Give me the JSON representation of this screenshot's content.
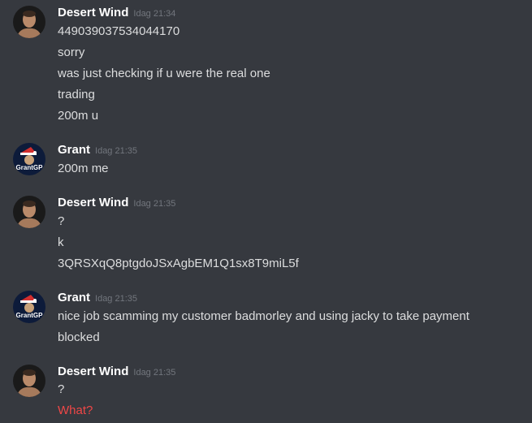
{
  "messages": [
    {
      "author": "Desert Wind",
      "timestamp": "Idag 21:34",
      "avatar_icon": "fighter-portrait-icon",
      "lines": [
        {
          "text": "449039037534044170"
        },
        {
          "text": "sorry"
        },
        {
          "text": "was just checking if u were the real one"
        },
        {
          "text": "trading"
        },
        {
          "text": "200m u"
        }
      ]
    },
    {
      "author": "Grant",
      "timestamp": "Idag 21:35",
      "avatar_icon": "grant-logo-icon",
      "avatar_text": "GrantGP",
      "lines": [
        {
          "text": "200m me"
        }
      ]
    },
    {
      "author": "Desert Wind",
      "timestamp": "Idag 21:35",
      "avatar_icon": "fighter-portrait-icon",
      "lines": [
        {
          "text": "?"
        },
        {
          "text": "k"
        },
        {
          "text": "3QRSXqQ8ptgdoJSxAgbEM1Q1sx8T9miL5f"
        }
      ]
    },
    {
      "author": "Grant",
      "timestamp": "Idag 21:35",
      "avatar_icon": "grant-logo-icon",
      "avatar_text": "GrantGP",
      "lines": [
        {
          "text": "nice job scamming my customer badmorley and using jacky to take payment"
        },
        {
          "text": "blocked"
        }
      ]
    },
    {
      "author": "Desert Wind",
      "timestamp": "Idag 21:35",
      "avatar_icon": "fighter-portrait-icon",
      "lines": [
        {
          "text": "?"
        },
        {
          "text": "What?",
          "color": "#f04747"
        }
      ]
    }
  ],
  "colors": {
    "background": "#36393f",
    "username": "#ffffff",
    "message_text": "#dcddde",
    "timestamp": "#72767d",
    "error_text": "#f04747"
  }
}
